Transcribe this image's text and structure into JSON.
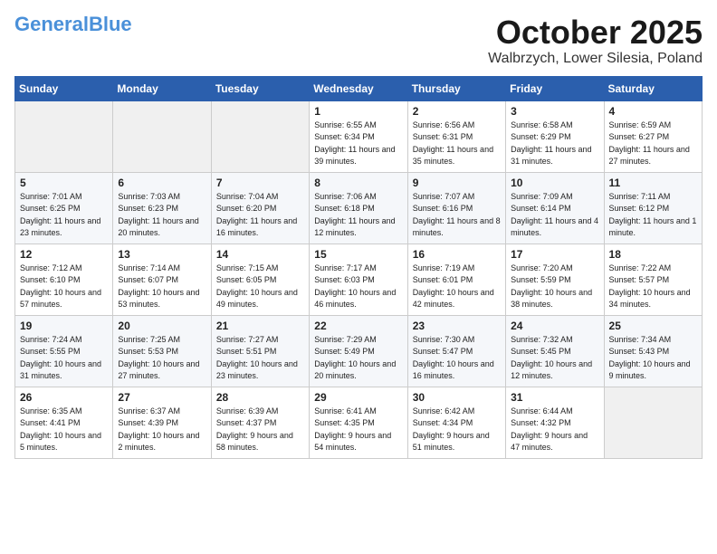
{
  "header": {
    "logo_main": "General",
    "logo_accent": "Blue",
    "month": "October 2025",
    "location": "Walbrzych, Lower Silesia, Poland"
  },
  "weekdays": [
    "Sunday",
    "Monday",
    "Tuesday",
    "Wednesday",
    "Thursday",
    "Friday",
    "Saturday"
  ],
  "weeks": [
    [
      {
        "day": "",
        "sunrise": "",
        "sunset": "",
        "daylight": ""
      },
      {
        "day": "",
        "sunrise": "",
        "sunset": "",
        "daylight": ""
      },
      {
        "day": "",
        "sunrise": "",
        "sunset": "",
        "daylight": ""
      },
      {
        "day": "1",
        "sunrise": "Sunrise: 6:55 AM",
        "sunset": "Sunset: 6:34 PM",
        "daylight": "Daylight: 11 hours and 39 minutes."
      },
      {
        "day": "2",
        "sunrise": "Sunrise: 6:56 AM",
        "sunset": "Sunset: 6:31 PM",
        "daylight": "Daylight: 11 hours and 35 minutes."
      },
      {
        "day": "3",
        "sunrise": "Sunrise: 6:58 AM",
        "sunset": "Sunset: 6:29 PM",
        "daylight": "Daylight: 11 hours and 31 minutes."
      },
      {
        "day": "4",
        "sunrise": "Sunrise: 6:59 AM",
        "sunset": "Sunset: 6:27 PM",
        "daylight": "Daylight: 11 hours and 27 minutes."
      }
    ],
    [
      {
        "day": "5",
        "sunrise": "Sunrise: 7:01 AM",
        "sunset": "Sunset: 6:25 PM",
        "daylight": "Daylight: 11 hours and 23 minutes."
      },
      {
        "day": "6",
        "sunrise": "Sunrise: 7:03 AM",
        "sunset": "Sunset: 6:23 PM",
        "daylight": "Daylight: 11 hours and 20 minutes."
      },
      {
        "day": "7",
        "sunrise": "Sunrise: 7:04 AM",
        "sunset": "Sunset: 6:20 PM",
        "daylight": "Daylight: 11 hours and 16 minutes."
      },
      {
        "day": "8",
        "sunrise": "Sunrise: 7:06 AM",
        "sunset": "Sunset: 6:18 PM",
        "daylight": "Daylight: 11 hours and 12 minutes."
      },
      {
        "day": "9",
        "sunrise": "Sunrise: 7:07 AM",
        "sunset": "Sunset: 6:16 PM",
        "daylight": "Daylight: 11 hours and 8 minutes."
      },
      {
        "day": "10",
        "sunrise": "Sunrise: 7:09 AM",
        "sunset": "Sunset: 6:14 PM",
        "daylight": "Daylight: 11 hours and 4 minutes."
      },
      {
        "day": "11",
        "sunrise": "Sunrise: 7:11 AM",
        "sunset": "Sunset: 6:12 PM",
        "daylight": "Daylight: 11 hours and 1 minute."
      }
    ],
    [
      {
        "day": "12",
        "sunrise": "Sunrise: 7:12 AM",
        "sunset": "Sunset: 6:10 PM",
        "daylight": "Daylight: 10 hours and 57 minutes."
      },
      {
        "day": "13",
        "sunrise": "Sunrise: 7:14 AM",
        "sunset": "Sunset: 6:07 PM",
        "daylight": "Daylight: 10 hours and 53 minutes."
      },
      {
        "day": "14",
        "sunrise": "Sunrise: 7:15 AM",
        "sunset": "Sunset: 6:05 PM",
        "daylight": "Daylight: 10 hours and 49 minutes."
      },
      {
        "day": "15",
        "sunrise": "Sunrise: 7:17 AM",
        "sunset": "Sunset: 6:03 PM",
        "daylight": "Daylight: 10 hours and 46 minutes."
      },
      {
        "day": "16",
        "sunrise": "Sunrise: 7:19 AM",
        "sunset": "Sunset: 6:01 PM",
        "daylight": "Daylight: 10 hours and 42 minutes."
      },
      {
        "day": "17",
        "sunrise": "Sunrise: 7:20 AM",
        "sunset": "Sunset: 5:59 PM",
        "daylight": "Daylight: 10 hours and 38 minutes."
      },
      {
        "day": "18",
        "sunrise": "Sunrise: 7:22 AM",
        "sunset": "Sunset: 5:57 PM",
        "daylight": "Daylight: 10 hours and 34 minutes."
      }
    ],
    [
      {
        "day": "19",
        "sunrise": "Sunrise: 7:24 AM",
        "sunset": "Sunset: 5:55 PM",
        "daylight": "Daylight: 10 hours and 31 minutes."
      },
      {
        "day": "20",
        "sunrise": "Sunrise: 7:25 AM",
        "sunset": "Sunset: 5:53 PM",
        "daylight": "Daylight: 10 hours and 27 minutes."
      },
      {
        "day": "21",
        "sunrise": "Sunrise: 7:27 AM",
        "sunset": "Sunset: 5:51 PM",
        "daylight": "Daylight: 10 hours and 23 minutes."
      },
      {
        "day": "22",
        "sunrise": "Sunrise: 7:29 AM",
        "sunset": "Sunset: 5:49 PM",
        "daylight": "Daylight: 10 hours and 20 minutes."
      },
      {
        "day": "23",
        "sunrise": "Sunrise: 7:30 AM",
        "sunset": "Sunset: 5:47 PM",
        "daylight": "Daylight: 10 hours and 16 minutes."
      },
      {
        "day": "24",
        "sunrise": "Sunrise: 7:32 AM",
        "sunset": "Sunset: 5:45 PM",
        "daylight": "Daylight: 10 hours and 12 minutes."
      },
      {
        "day": "25",
        "sunrise": "Sunrise: 7:34 AM",
        "sunset": "Sunset: 5:43 PM",
        "daylight": "Daylight: 10 hours and 9 minutes."
      }
    ],
    [
      {
        "day": "26",
        "sunrise": "Sunrise: 6:35 AM",
        "sunset": "Sunset: 4:41 PM",
        "daylight": "Daylight: 10 hours and 5 minutes."
      },
      {
        "day": "27",
        "sunrise": "Sunrise: 6:37 AM",
        "sunset": "Sunset: 4:39 PM",
        "daylight": "Daylight: 10 hours and 2 minutes."
      },
      {
        "day": "28",
        "sunrise": "Sunrise: 6:39 AM",
        "sunset": "Sunset: 4:37 PM",
        "daylight": "Daylight: 9 hours and 58 minutes."
      },
      {
        "day": "29",
        "sunrise": "Sunrise: 6:41 AM",
        "sunset": "Sunset: 4:35 PM",
        "daylight": "Daylight: 9 hours and 54 minutes."
      },
      {
        "day": "30",
        "sunrise": "Sunrise: 6:42 AM",
        "sunset": "Sunset: 4:34 PM",
        "daylight": "Daylight: 9 hours and 51 minutes."
      },
      {
        "day": "31",
        "sunrise": "Sunrise: 6:44 AM",
        "sunset": "Sunset: 4:32 PM",
        "daylight": "Daylight: 9 hours and 47 minutes."
      },
      {
        "day": "",
        "sunrise": "",
        "sunset": "",
        "daylight": ""
      }
    ]
  ]
}
